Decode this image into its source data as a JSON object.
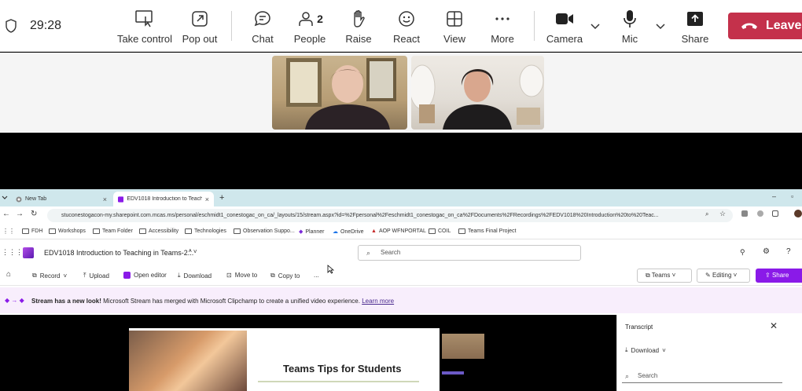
{
  "meeting": {
    "timer": "29:28",
    "toolbar": [
      {
        "id": "take-control",
        "label": "Take control",
        "icon": "take-control-icon"
      },
      {
        "id": "pop-out",
        "label": "Pop out",
        "icon": "pop-out-icon"
      },
      {
        "id": "chat",
        "label": "Chat",
        "icon": "chat-icon"
      },
      {
        "id": "people",
        "label": "People",
        "icon": "people-icon",
        "count": "2"
      },
      {
        "id": "raise",
        "label": "Raise",
        "icon": "raise-hand-icon"
      },
      {
        "id": "react",
        "label": "React",
        "icon": "react-smile-icon"
      },
      {
        "id": "view",
        "label": "View",
        "icon": "view-grid-icon"
      },
      {
        "id": "more",
        "label": "More",
        "icon": "more-icon"
      },
      {
        "id": "camera",
        "label": "Camera",
        "icon": "camera-icon"
      },
      {
        "id": "mic",
        "label": "Mic",
        "icon": "mic-icon"
      },
      {
        "id": "share",
        "label": "Share",
        "icon": "share-icon"
      }
    ],
    "leave_label": "Leave",
    "colors": {
      "leave": "#c4314b",
      "accent": "#8a1ae8"
    }
  },
  "browser": {
    "tabs": [
      {
        "label": "New Tab"
      },
      {
        "label": "EDV1018 Introduction to Teachi..."
      }
    ],
    "address": "stuconestogacon-my.sharepoint.com.mcas.ms/personal/eschmidt1_conestogac_on_ca/_layouts/15/stream.aspx?id=%2Fpersonal%2Feschmidt1_conestogac_on_ca%2FDocuments%2FRecordings%2FEDV1018%20Introduction%20to%20Teac...",
    "bookmarks": [
      "FDH",
      "Workshops",
      "Team Folder",
      "Accessibility",
      "Technologies",
      "Observation Suppo...",
      "Planner",
      "OneDrive",
      "AOP WFNPORTAL",
      "COIL",
      "Teams Final Project"
    ]
  },
  "sharepoint": {
    "file_title": "EDV1018 Introduction to Teaching in Teams-2...",
    "search_placeholder": "Search",
    "commands": [
      "Record",
      "Upload",
      "Open editor",
      "Download",
      "Move to",
      "Copy to",
      "..."
    ],
    "teams_label": "Teams",
    "editing_label": "Editing",
    "share_label": "Share",
    "notice_bold": "Stream has a new look!",
    "notice_text": " Microsoft Stream has merged with Microsoft Clipchamp to create a unified video experience. ",
    "notice_link": "Learn more"
  },
  "video": {
    "slide_title": "Teams Tips for Students"
  },
  "transcript": {
    "title": "Transcript",
    "download_label": "Download",
    "search_placeholder": "Search"
  }
}
